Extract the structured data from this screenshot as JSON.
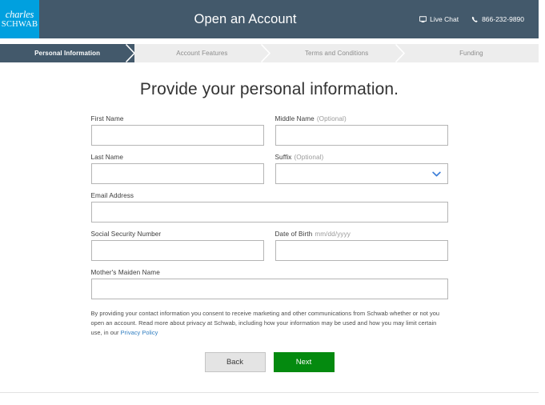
{
  "header": {
    "logo_line1": "charles",
    "logo_line2": "SCHWAB",
    "logo_bg": "#00a0df",
    "bar_bg": "#43596b",
    "title": "Open an Account",
    "live_chat_label": "Live Chat",
    "phone_label": "866-232-9890"
  },
  "steps": [
    {
      "label": "Personal Information",
      "active": true
    },
    {
      "label": "Account Features",
      "active": false
    },
    {
      "label": "Terms and Conditions",
      "active": false
    },
    {
      "label": "Funding",
      "active": false
    }
  ],
  "main": {
    "page_title": "Provide your personal information.",
    "fields": {
      "first_name": {
        "label": "First Name",
        "value": "",
        "placeholder": ""
      },
      "middle_name": {
        "label": "Middle Name",
        "optional": "(Optional)",
        "value": "",
        "placeholder": ""
      },
      "last_name": {
        "label": "Last Name",
        "value": "",
        "placeholder": ""
      },
      "suffix": {
        "label": "Suffix",
        "optional": "(Optional)",
        "value": ""
      },
      "email": {
        "label": "Email Address",
        "value": "",
        "placeholder": ""
      },
      "ssn": {
        "label": "Social Security Number",
        "value": "",
        "placeholder": ""
      },
      "dob": {
        "label": "Date of Birth",
        "hint": "mm/dd/yyyy",
        "value": "",
        "placeholder": ""
      },
      "mothers_maiden_name": {
        "label": "Mother's Maiden Name",
        "value": "",
        "placeholder": ""
      }
    },
    "disclaimer": {
      "text": "By providing your contact information you consent to receive marketing and other communications from Schwab whether or not you open an account. Read more about privacy at Schwab, including how your information may be used and how you may limit certain use, in our ",
      "link_text": "Privacy Policy",
      "link_color": "#2f7dc0"
    },
    "buttons": {
      "back_label": "Back",
      "next_label": "Next",
      "next_color": "#048a0f"
    }
  }
}
